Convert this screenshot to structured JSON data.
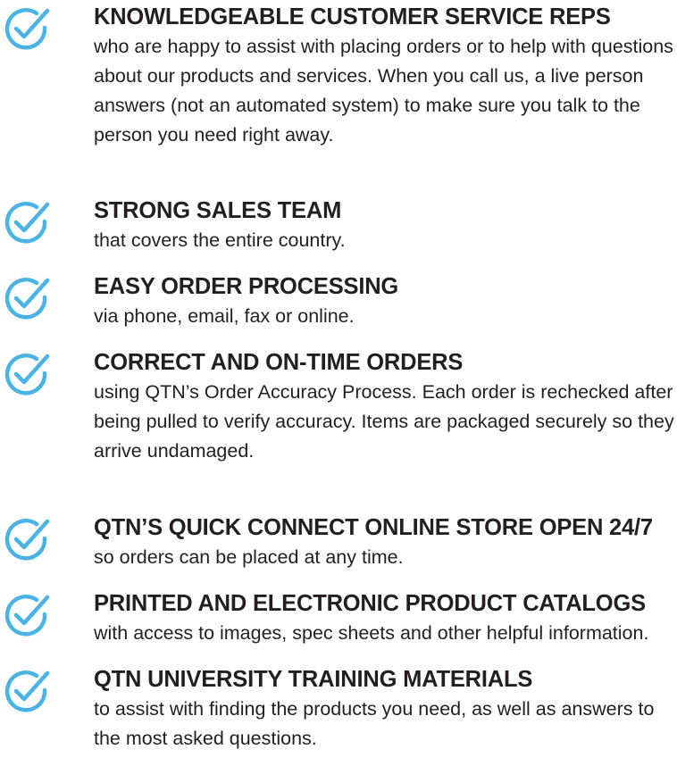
{
  "colors": {
    "check_icon": "#4ab3e6",
    "text": "#231f20"
  },
  "icon": "circle-check-icon",
  "features": [
    {
      "heading": "KNOWLEDGEABLE CUSTOMER SERVICE REPS",
      "description": "who are happy to assist with placing orders or to help with questions about our products and services. When you call us, a live person answers (not an automated system) to make sure you talk to the person you need right away."
    },
    {
      "heading": "STRONG SALES TEAM",
      "description": "that covers the entire country."
    },
    {
      "heading": "EASY ORDER PROCESSING",
      "description": "via phone, email, fax or online."
    },
    {
      "heading": "CORRECT AND ON-TIME ORDERS",
      "description": "using QTN’s Order Accuracy Process. Each order is rechecked after being pulled to verify accuracy. Items are packaged securely so they arrive undamaged."
    },
    {
      "heading": "QTN’S QUICK CONNECT ONLINE STORE OPEN 24/7",
      "description": "so orders can be placed at any time."
    },
    {
      "heading": "PRINTED AND ELECTRONIC PRODUCT CATALOGS",
      "description": "with access to images, spec sheets and other helpful information."
    },
    {
      "heading": "QTN UNIVERSITY TRAINING MATERIALS",
      "description": "to assist with finding the products you need, as well as answers to the most asked questions."
    }
  ]
}
